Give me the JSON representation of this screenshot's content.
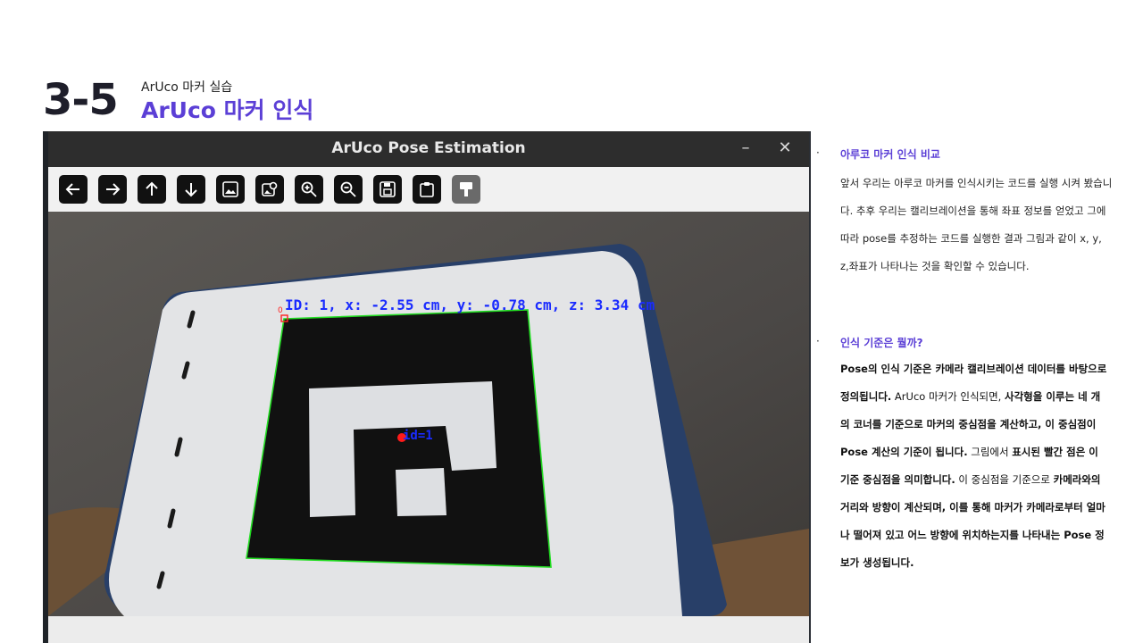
{
  "header": {
    "number": "3-5",
    "subtitle": "ArUco 마커 실습",
    "title": "ArUco 마커 인식"
  },
  "window": {
    "title": "ArUco Pose Estimation",
    "minimize_glyph": "–",
    "close_glyph": "✕",
    "toolbar": [
      {
        "icon": "arrow-left-icon"
      },
      {
        "icon": "arrow-right-icon"
      },
      {
        "icon": "arrow-up-icon"
      },
      {
        "icon": "arrow-down-icon"
      },
      {
        "icon": "image-icon"
      },
      {
        "icon": "image-settings-icon"
      },
      {
        "icon": "zoom-in-icon"
      },
      {
        "icon": "zoom-out-icon"
      },
      {
        "icon": "save-icon"
      },
      {
        "icon": "clipboard-icon"
      },
      {
        "icon": "paint-brush-icon"
      }
    ],
    "overlay": {
      "pose_text": "ID: 1, x: -2.55 cm, y: -0.78 cm, z: 3.34 cm",
      "marker_id_text": "id=1",
      "corner_label": "0"
    }
  },
  "notes": {
    "section1": {
      "bullet": "·",
      "heading": "아루코 마커 인식 비교",
      "body": "앞서 우리는 아루코 마커를 인식시키는 코드를 실행 시켜 봤습니다. 추후 우리는 캘리브레이션을 통해 좌표 정보를 얻었고 그에 따라 pose를 추정하는 코드를 실행한 결과 그림과 같이 x, y, z,좌표가 나타나는 것을 확인할 수 있습니다."
    },
    "section2": {
      "bullet": "·",
      "heading": "인식 기준은 뭘까?",
      "b1": "Pose의 인식 기준은 카메라 캘리브레이션 데이터를 바탕으로 정의됩니다.",
      "t1": " ArUco 마커가 인식되면, ",
      "b2": "사각형을 이루는 네 개의 코너를 기준으로 마커의 중심점을 계산하고, 이 중심점이 Pose 계산의 기준이 됩니다.",
      "t2": " 그림에서 ",
      "b3": "표시된 빨간 점은 이 기준 중심점을 의미합니다.",
      "t3": " 이 중심점을 기준으로 ",
      "b4": "카메라와의 거리와 방향이 계산되며, 이를 통해 마커가 카메라로부터 얼마나 떨어져 있고 어느 방향에 위치하는지를 나타내는 Pose 정보가 생성됩니다."
    }
  },
  "colors": {
    "accent": "#5b3fd6",
    "marker_outline": "#22dd22",
    "overlay_text": "#1a2bff",
    "center_point": "#ff1a1a"
  }
}
